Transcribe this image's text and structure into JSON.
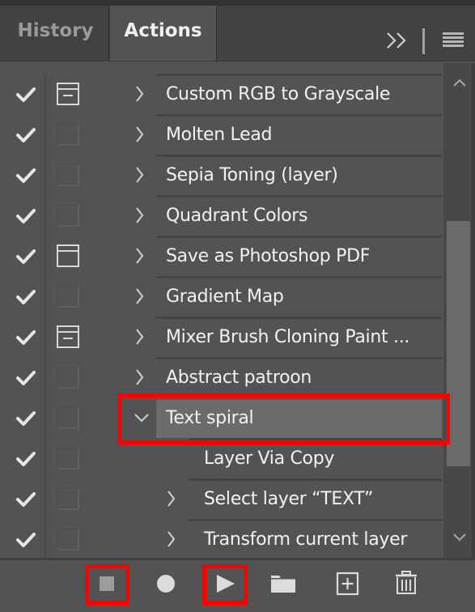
{
  "tabs": [
    {
      "label": "History",
      "active": false
    },
    {
      "label": "Actions",
      "active": true
    }
  ],
  "panel_controls": {
    "collapse_icon": "double-chevron-right-icon",
    "menu_icon": "hamburger-menu-icon"
  },
  "actions": [
    {
      "label": "Custom RGB to Grayscale",
      "checked": true,
      "dialog": "partial",
      "expanded": false,
      "nested": false,
      "selected": false
    },
    {
      "label": "Molten Lead",
      "checked": true,
      "dialog": "none",
      "expanded": false,
      "nested": false,
      "selected": false
    },
    {
      "label": "Sepia Toning (layer)",
      "checked": true,
      "dialog": "none",
      "expanded": false,
      "nested": false,
      "selected": false
    },
    {
      "label": "Quadrant Colors",
      "checked": true,
      "dialog": "none",
      "expanded": false,
      "nested": false,
      "selected": false
    },
    {
      "label": "Save as Photoshop PDF",
      "checked": true,
      "dialog": "full",
      "expanded": false,
      "nested": false,
      "selected": false
    },
    {
      "label": "Gradient Map",
      "checked": true,
      "dialog": "none",
      "expanded": false,
      "nested": false,
      "selected": false
    },
    {
      "label": "Mixer Brush Cloning Paint ...",
      "checked": true,
      "dialog": "partial",
      "expanded": false,
      "nested": false,
      "selected": false
    },
    {
      "label": "Abstract patroon",
      "checked": true,
      "dialog": "none",
      "expanded": false,
      "nested": false,
      "selected": false
    },
    {
      "label": "Text spiral",
      "checked": true,
      "dialog": "none",
      "expanded": true,
      "nested": false,
      "selected": true
    },
    {
      "label": "Layer Via Copy",
      "checked": true,
      "dialog": "none",
      "expanded": null,
      "nested": true,
      "selected": false
    },
    {
      "label": "Select layer “TEXT”",
      "checked": true,
      "dialog": "none",
      "expanded": false,
      "nested": true,
      "selected": false
    },
    {
      "label": "Transform current layer",
      "checked": true,
      "dialog": "none",
      "expanded": false,
      "nested": true,
      "selected": false
    }
  ],
  "scrollbar": {
    "position_fraction": 0.5,
    "visible_fraction": 0.55
  },
  "toolbar": [
    {
      "name": "stop-playing-button",
      "icon": "stop-icon",
      "highlighted": true
    },
    {
      "name": "begin-recording-button",
      "icon": "record-icon",
      "highlighted": false
    },
    {
      "name": "play-selection-button",
      "icon": "play-icon",
      "highlighted": true
    },
    {
      "name": "create-new-set-button",
      "icon": "folder-icon",
      "highlighted": false
    },
    {
      "name": "create-new-action-button",
      "icon": "new-item-icon",
      "highlighted": false
    },
    {
      "name": "delete-button",
      "icon": "trash-icon",
      "highlighted": false
    }
  ],
  "colors": {
    "panel_bg": "#535353",
    "tabbar_bg": "#424242",
    "selected_row_bg": "#6b6b6b",
    "highlight": "#ff0000",
    "text": "#f2f2f2"
  }
}
